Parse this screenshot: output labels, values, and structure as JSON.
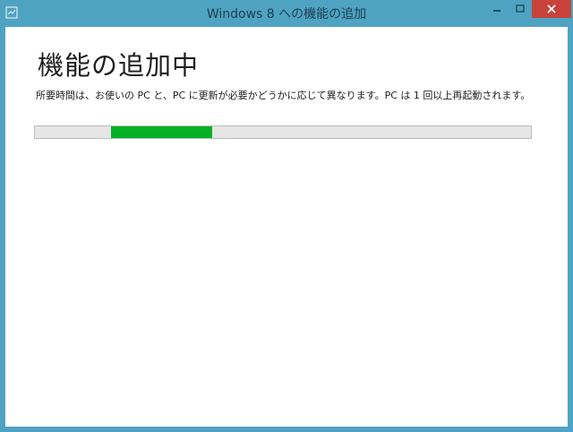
{
  "window": {
    "title": "Windows 8 への機能の追加",
    "controls": {
      "minimize_icon": "minimize-icon",
      "maximize_icon": "maximize-icon",
      "close_icon": "close-icon"
    }
  },
  "content": {
    "heading": "機能の追加中",
    "description": "所要時間は、お使いの PC と、PC に更新が必要かどうかに応じて異なります。PC は 1 回以上再起動されます。"
  },
  "progress": {
    "style": "marquee",
    "segment_start_fraction": 0.153,
    "segment_end_fraction": 0.358,
    "colors": {
      "fill": "#06b025",
      "track": "#e6e6e6"
    }
  },
  "colors": {
    "window_frame": "#4fa3c2",
    "close_button": "#c8433b"
  }
}
